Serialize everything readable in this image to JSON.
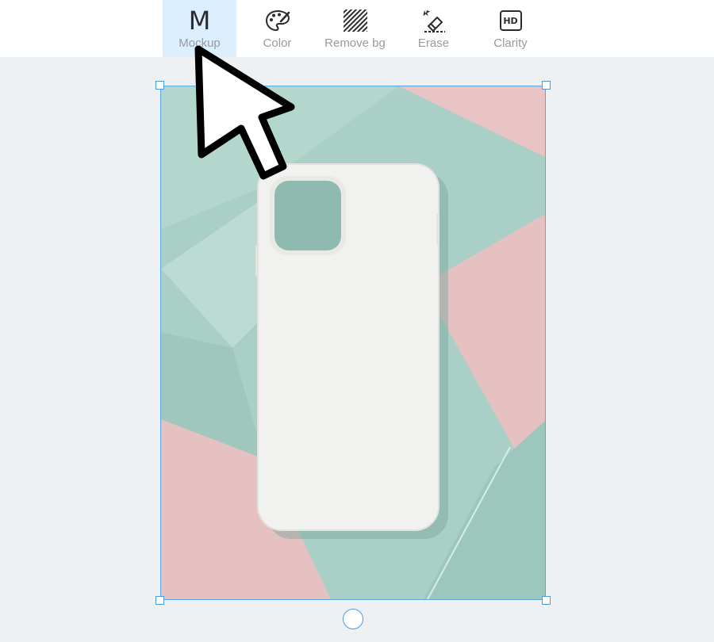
{
  "toolbar": {
    "tools": [
      {
        "label": "Mockup",
        "icon": "letter-m-icon",
        "glyph": "M",
        "active": true
      },
      {
        "label": "Color",
        "icon": "palette-icon",
        "active": false
      },
      {
        "label": "Remove bg",
        "icon": "hatched-square-icon",
        "active": false
      },
      {
        "label": "Erase",
        "icon": "eraser-icon",
        "active": false
      },
      {
        "label": "Clarity",
        "icon": "hd-icon",
        "glyph": "HD",
        "active": false
      }
    ]
  },
  "image": {
    "description_icon": "phone-case-mockup-image",
    "colors": {
      "mint": "#a9cfc6",
      "pink": "#e6c1c1",
      "case": "#f1f1ef",
      "selection": "#4a9be0"
    }
  },
  "colors": {
    "toolbar_bg": "#ffffff",
    "canvas_bg": "#edf1f3",
    "active_tool_bg": "#dcefff",
    "label": "#9a9a9a"
  }
}
